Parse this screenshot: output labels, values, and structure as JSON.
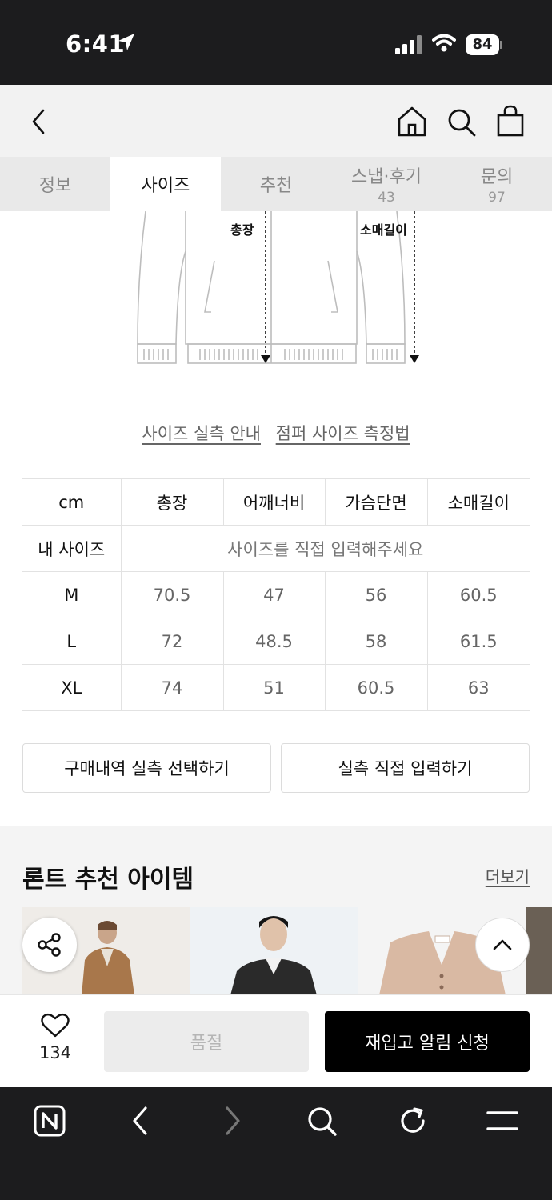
{
  "status_bar": {
    "time": "6:41",
    "battery": "84"
  },
  "header": {
    "icons": [
      "back-icon",
      "home-icon",
      "search-icon",
      "shopping-bag-icon"
    ]
  },
  "tabs": [
    {
      "label": "정보",
      "count": ""
    },
    {
      "label": "사이즈",
      "count": ""
    },
    {
      "label": "추천",
      "count": ""
    },
    {
      "label": "스냅·후기",
      "count": "43"
    },
    {
      "label": "문의",
      "count": "97"
    }
  ],
  "illustration": {
    "length_label": "총장",
    "sleeve_label": "소매길이"
  },
  "guide_links": {
    "actual_size": "사이즈 실측 안내",
    "measure_method": "점퍼 사이즈 측정법"
  },
  "size_table": {
    "unit": "cm",
    "columns": [
      "총장",
      "어깨너비",
      "가슴단면",
      "소매길이"
    ],
    "my_size_label": "내 사이즈",
    "my_size_hint": "사이즈를 직접 입력해주세요",
    "rows": [
      {
        "size": "M",
        "values": [
          "70.5",
          "47",
          "56",
          "60.5"
        ]
      },
      {
        "size": "L",
        "values": [
          "72",
          "48.5",
          "58",
          "61.5"
        ]
      },
      {
        "size": "XL",
        "values": [
          "74",
          "51",
          "60.5",
          "63"
        ]
      }
    ]
  },
  "buttons": {
    "select_purchase": "구매내역 실측 선택하기",
    "direct_input": "실측 직접 입력하기"
  },
  "recommend": {
    "title": "론트 추천 아이템",
    "more": "더보기"
  },
  "buy_bar": {
    "like_count": "134",
    "soldout": "품절",
    "restock": "재입고 알림 신청"
  },
  "colors": {
    "accent": "#000000",
    "status_bg": "#1c1c1e",
    "tab_bg": "#e9e9e9"
  }
}
